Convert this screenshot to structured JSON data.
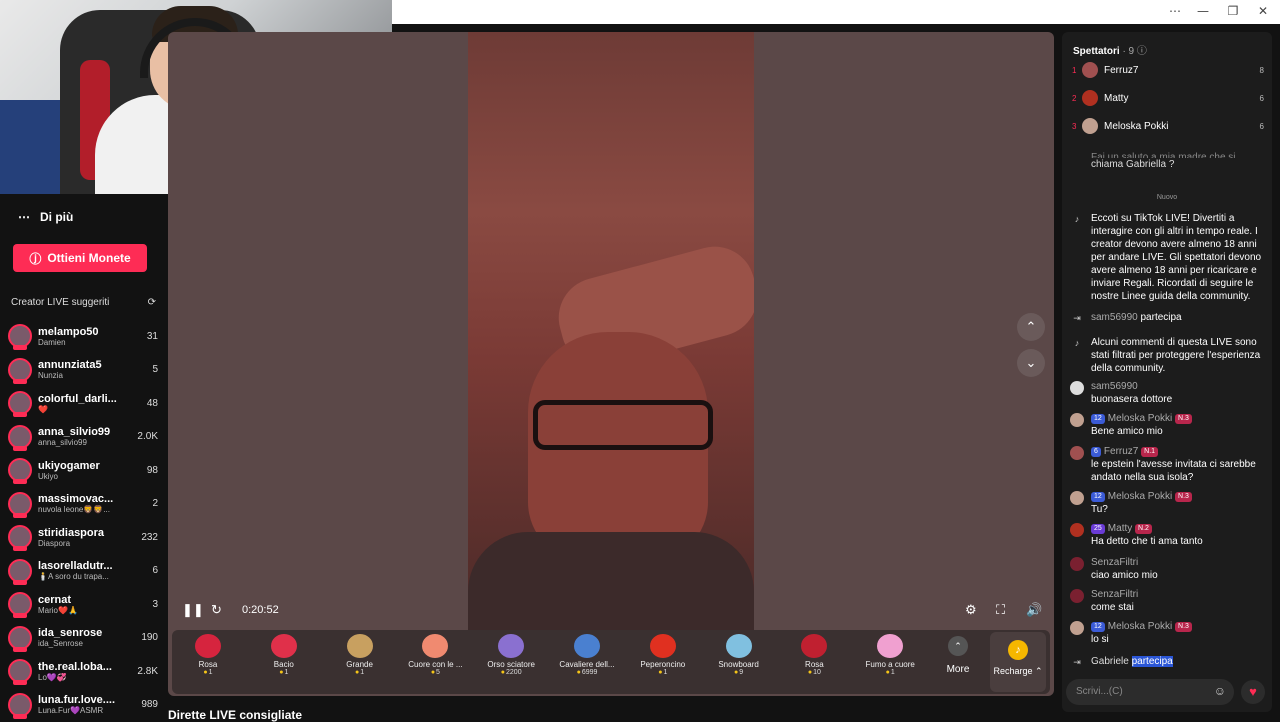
{
  "window": {
    "minimize": "⋯",
    "min": "—",
    "max": "❐",
    "close": "✕"
  },
  "sidebar": {
    "more_label": "Di più",
    "coins_button": "Ottieni Monete",
    "suggested_title": "Creator LIVE suggeriti",
    "creators": [
      {
        "name": "melampo50",
        "sub": "Damien",
        "count": "31"
      },
      {
        "name": "annunziata5",
        "sub": "Nunzia",
        "count": "5"
      },
      {
        "name": "colorful_darli...",
        "sub": "❤️",
        "count": "48"
      },
      {
        "name": "anna_silvio99",
        "sub": "anna_silvio99",
        "count": "2.0K"
      },
      {
        "name": "ukiyogamer",
        "sub": "Ukiyo",
        "count": "98"
      },
      {
        "name": "massimovac...",
        "sub": "nuvola leone🦁🦁...",
        "count": "2"
      },
      {
        "name": "stiridiaspora",
        "sub": "Diaspora",
        "count": "232"
      },
      {
        "name": "lasorelladutr...",
        "sub": "🕯️A soro du trapa...",
        "count": "6"
      },
      {
        "name": "cernat",
        "sub": "Mario❤️🙏",
        "count": "3"
      },
      {
        "name": "ida_senrose",
        "sub": "ida_Senrose",
        "count": "190"
      },
      {
        "name": "the.real.loba...",
        "sub": "Lo💜💞",
        "count": "2.8K"
      },
      {
        "name": "luna.fur.love....",
        "sub": "Luna.Fur💜ASMR",
        "count": "989"
      }
    ],
    "recommended": "Dirette LIVE consigliate"
  },
  "player": {
    "time": "0:20:52"
  },
  "gifts": [
    {
      "name": "Rosa",
      "price": "1",
      "color": "#d6243e"
    },
    {
      "name": "Bacio",
      "price": "1",
      "color": "#e0304a"
    },
    {
      "name": "Grande",
      "price": "1",
      "color": "#c8a060"
    },
    {
      "name": "Cuore con le ...",
      "price": "5",
      "color": "#f08a70"
    },
    {
      "name": "Orso sciatore",
      "price": "2200",
      "color": "#8a70d0"
    },
    {
      "name": "Cavaliere dell...",
      "price": "6999",
      "color": "#4a80d0"
    },
    {
      "name": "Peperoncino",
      "price": "1",
      "color": "#e03020"
    },
    {
      "name": "Snowboard",
      "price": "9",
      "color": "#80c0e0"
    },
    {
      "name": "Rosa",
      "price": "10",
      "color": "#c02030"
    },
    {
      "name": "Fumo a cuore",
      "price": "1",
      "color": "#f0a0d0"
    }
  ],
  "gift_more": "More",
  "gift_recharge": "Recharge ⌃",
  "chat": {
    "viewers_title": "Spettatori",
    "viewers_count": "· 9",
    "top": [
      {
        "rank": "1",
        "name": "Ferruz7",
        "score": "8",
        "color": "#a05050"
      },
      {
        "rank": "2",
        "name": "Matty",
        "score": "6",
        "color": "#b03020"
      },
      {
        "rank": "3",
        "name": "Meloska Pokki",
        "score": "6",
        "color": "#c0a090"
      }
    ],
    "partial_msg": "chiama Gabriella ?",
    "partial_msg_top": "Fai un saluto a mia madre che si",
    "new_label": "Nuovo",
    "sys1": "Eccoti su TikTok LIVE! Divertiti a interagire con gli altri in tempo reale. I creator devono avere almeno 18 anni per andare LIVE. Gli spettatori devono avere almeno 18 anni per ricaricare e inviare Regali. Ricordati di seguire le nostre Linee guida della community.",
    "join1_user": "sam56990",
    "join1_text": "partecipa",
    "sys2": "Alcuni commenti di questa LIVE sono stati filtrati per proteggere l'esperienza della community.",
    "messages": [
      {
        "user": "sam56990",
        "lv": "",
        "rank": "",
        "text": "buonasera dottore",
        "color": "#ddd"
      },
      {
        "user": "Meloska Pokki",
        "lv": "12",
        "rank": "N.3",
        "text": "Bene amico mio",
        "color": "#c0a090"
      },
      {
        "user": "Ferruz7",
        "lv": "6",
        "rank": "N.1",
        "text": "le epstein l'avesse invitata ci sarebbe andato nella sua isola?",
        "color": "#a05050"
      },
      {
        "user": "Meloska Pokki",
        "lv": "12",
        "rank": "N.3",
        "text": "Tu?",
        "color": "#c0a090"
      },
      {
        "user": "Matty",
        "lv": "25",
        "rank": "N.2",
        "text": "Ha detto che ti ama tanto",
        "color": "#b03020"
      },
      {
        "user": "SenzaFiltri",
        "lv": "",
        "rank": "",
        "text": "ciao amico mio",
        "color": "#7a2030"
      },
      {
        "user": "SenzaFiltri",
        "lv": "",
        "rank": "",
        "text": "come stai",
        "color": "#7a2030"
      },
      {
        "user": "Meloska Pokki",
        "lv": "12",
        "rank": "N.3",
        "text": "lo si",
        "color": "#c0a090"
      }
    ],
    "join2_user": "Gabriele",
    "join2_text": "partecipa",
    "placeholder": "Scrivi...(C)"
  }
}
